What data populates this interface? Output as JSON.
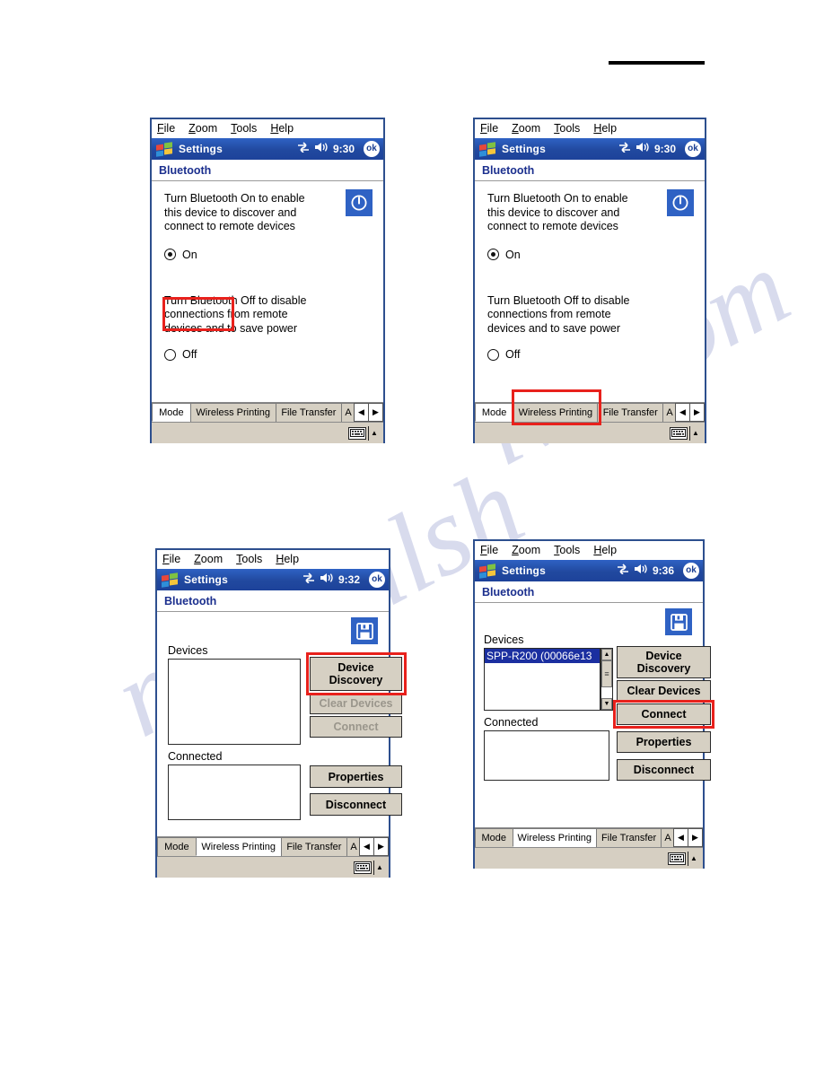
{
  "document": {
    "watermark_text_1": "manualsh",
    "watermark_text_2": "ive.com"
  },
  "menu": {
    "items": [
      {
        "accel": "F",
        "rest": "ile"
      },
      {
        "accel": "Z",
        "rest": "oom"
      },
      {
        "accel": "T",
        "rest": "ools"
      },
      {
        "accel": "H",
        "rest": "elp"
      }
    ]
  },
  "icons": {
    "windows_flag": "windows-flag-icon",
    "connectivity": "connectivity-icon",
    "volume": "volume-icon",
    "ok": "ok",
    "power": "power-icon",
    "printer": "printer-icon",
    "keyboard": "keyboard-icon",
    "arrow_up": "▲",
    "arrow_down": "▼",
    "arrow_left": "◀",
    "arrow_right": "▶"
  },
  "colors": {
    "titlebar_blue": "#21499f",
    "accent_blue": "#2f62c4",
    "heading_blue": "#1b2f8e",
    "highlight_red": "#e8211c",
    "selection_blue": "#1b2fa0",
    "button_face": "#d6d0c3",
    "window_border": "#2d4f8e"
  },
  "panels": [
    {
      "id": "panel-mode-on",
      "title": "Settings",
      "time": "9:30",
      "heading": "Bluetooth",
      "desc_on": "Turn Bluetooth On to enable\nthis device to discover and\nconnect to remote devices",
      "radio_on_label": "On",
      "desc_off": "Turn Bluetooth Off to disable\nconnections from remote\ndevices and to save power",
      "radio_off_label": "Off",
      "tabs": [
        {
          "label": "Mode",
          "active": true
        },
        {
          "label": "Wireless Printing",
          "active": false
        },
        {
          "label": "File Transfer",
          "active": false
        },
        {
          "label": "A",
          "active": false
        }
      ],
      "highlight": "On radio button"
    },
    {
      "id": "panel-mode-tab",
      "title": "Settings",
      "time": "9:30",
      "heading": "Bluetooth",
      "desc_on": "Turn Bluetooth On to enable\nthis device to discover and\nconnect to remote devices",
      "radio_on_label": "On",
      "desc_off": "Turn Bluetooth Off to disable\nconnections from remote\ndevices and to save power",
      "radio_off_label": "Off",
      "tabs": [
        {
          "label": "Mode",
          "active": true
        },
        {
          "label": "Wireless Printing",
          "active": false
        },
        {
          "label": "File Transfer",
          "active": false
        },
        {
          "label": "A",
          "active": false
        }
      ],
      "highlight": "Wireless Printing tab"
    },
    {
      "id": "panel-wireless-empty",
      "title": "Settings",
      "time": "9:32",
      "heading": "Bluetooth",
      "devices_label": "Devices",
      "devices_items": [],
      "connected_label": "Connected",
      "connected_items": [],
      "buttons": {
        "device_discovery": "Device\nDiscovery",
        "clear_devices": "Clear Devices",
        "connect": "Connect",
        "properties": "Properties",
        "disconnect": "Disconnect"
      },
      "tabs": [
        {
          "label": "Mode",
          "active": false
        },
        {
          "label": "Wireless Printing",
          "active": true
        },
        {
          "label": "File Transfer",
          "active": false
        },
        {
          "label": "A",
          "active": false
        }
      ],
      "highlight": "Device Discovery button"
    },
    {
      "id": "panel-wireless-found",
      "title": "Settings",
      "time": "9:36",
      "heading": "Bluetooth",
      "devices_label": "Devices",
      "devices_items": [
        "SPP-R200 (00066e13"
      ],
      "connected_label": "Connected",
      "connected_items": [],
      "buttons": {
        "device_discovery": "Device\nDiscovery",
        "clear_devices": "Clear Devices",
        "connect": "Connect",
        "properties": "Properties",
        "disconnect": "Disconnect"
      },
      "tabs": [
        {
          "label": "Mode",
          "active": false
        },
        {
          "label": "Wireless Printing",
          "active": true
        },
        {
          "label": "File Transfer",
          "active": false
        },
        {
          "label": "A",
          "active": false
        }
      ],
      "highlight": "Connect button"
    }
  ]
}
